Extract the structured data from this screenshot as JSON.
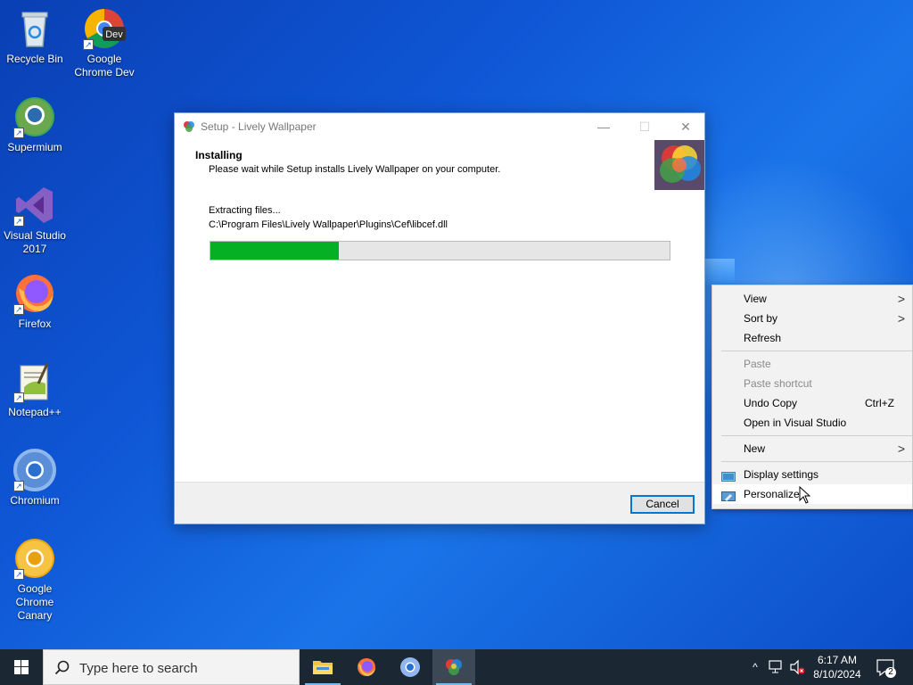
{
  "desktop": {
    "icons": [
      {
        "label": "Recycle Bin"
      },
      {
        "label": "Google Chrome Dev",
        "badge": "Dev"
      },
      {
        "label": "Supermium"
      },
      {
        "label": "Visual Studio 2017"
      },
      {
        "label": "Firefox"
      },
      {
        "label": "Notepad++"
      },
      {
        "label": "Chromium"
      },
      {
        "label": "Google Chrome Canary"
      }
    ]
  },
  "window": {
    "title": "Setup - Lively Wallpaper",
    "heading": "Installing",
    "subheading": "Please wait while Setup installs Lively Wallpaper on your computer.",
    "status": "Extracting files...",
    "file_path": "C:\\Program Files\\Lively Wallpaper\\Plugins\\Cef\\libcef.dll",
    "progress_fraction": 0.28,
    "cancel_label": "Cancel",
    "minimize_glyph": "—",
    "maximize_glyph": "☐",
    "close_glyph": "✕"
  },
  "context_menu": {
    "items": [
      {
        "label": "View",
        "submenu": true
      },
      {
        "label": "Sort by",
        "submenu": true
      },
      {
        "label": "Refresh"
      },
      {
        "label": "Paste",
        "disabled": true
      },
      {
        "label": "Paste shortcut",
        "disabled": true
      },
      {
        "label": "Undo Copy",
        "shortcut": "Ctrl+Z"
      },
      {
        "label": "Open in Visual Studio"
      },
      {
        "label": "New",
        "submenu": true
      },
      {
        "label": "Display settings",
        "icon": "display-icon"
      },
      {
        "label": "Personalize",
        "icon": "personalize-icon"
      }
    ],
    "arrow_glyph": ">"
  },
  "taskbar": {
    "search_placeholder": "Type here to search",
    "time": "6:17 AM",
    "date": "8/10/2024",
    "notification_count": "2",
    "chevron_glyph": "^"
  },
  "colors": {
    "accent": "#0078d7",
    "progress": "#06b025",
    "taskbar": "#1c2734"
  }
}
